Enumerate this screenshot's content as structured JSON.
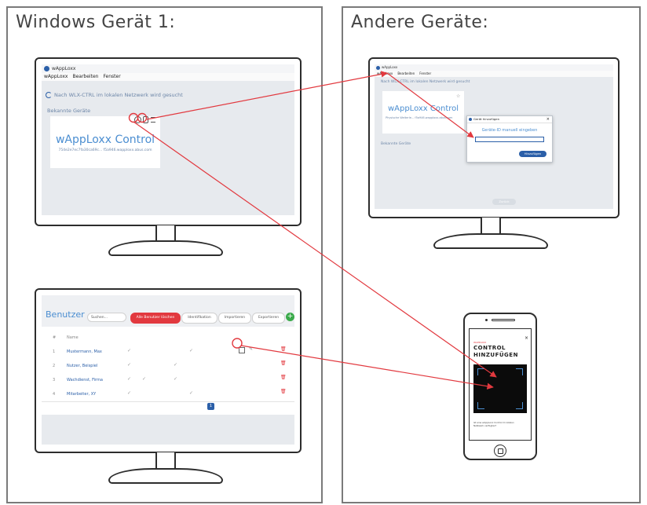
{
  "panels": {
    "left_title": "Windows Gerät 1:",
    "right_title": "Andere Geräte:"
  },
  "desktop_app": {
    "app_title": "wAppLoxx",
    "menu": [
      "wAppLoxx",
      "Bearbeiten",
      "Fenster"
    ],
    "search_status": "Nach WLX-CTRL im lokalen Netzwerk wird gesucht",
    "known_devices": "Bekannte Geräte",
    "card_title": "wAppLoxx Control",
    "card_id": "754e2e7ec7fa30ca69c... f5a946.wapploxx.abus.com"
  },
  "other_app": {
    "app_title": "wAppLoxx",
    "menu": [
      "wAppLoxx",
      "Bearbeiten",
      "Fenster"
    ],
    "search_status": "Nach WLX-CTRL im lokalen Netzwerk wird gesucht",
    "card_title": "wAppLoxx Control",
    "card_sub": "Physische Weiterle...   f5a946.wapploxx.abus.com",
    "known_devices": "Bekannte Geräte",
    "dialog_title": "Gerät hinzufügen",
    "dialog_prompt": "Geräte-ID manuell eingeben",
    "dialog_button": "Hinzufügen",
    "bottom_button": "Zurück"
  },
  "users_app": {
    "title": "Benutzer",
    "search_placeholder": "Suchen...",
    "btn_delete": "Alle Benutzer löschen",
    "btn_ident": "Identifikation",
    "btn_import": "Importieren",
    "btn_export": "Exportieren",
    "col_num": "#",
    "col_name": "Name",
    "rows": [
      {
        "num": "1",
        "name": "Mustermann, Max"
      },
      {
        "num": "2",
        "name": "Nutzer, Beispiel"
      },
      {
        "num": "3",
        "name": "Wachdienst, Firma"
      },
      {
        "num": "4",
        "name": "Mitarbeiter, XY"
      }
    ],
    "page": "1"
  },
  "phone": {
    "brand": "WAPPLOXX",
    "heading_line1": "CONTROL",
    "heading_line2": "HINZUFÜGEN",
    "footer_text": "Ist eine wAppLoxx Control im lokalen Netzwerk verfügbar?"
  },
  "colors": {
    "panel_border": "#7a7a7a",
    "arrow": "#e2393f",
    "brand_blue": "#4b8ed1",
    "button_red": "#e2393f",
    "button_blue": "#2b5fa8",
    "add_green": "#3aaa4a"
  }
}
